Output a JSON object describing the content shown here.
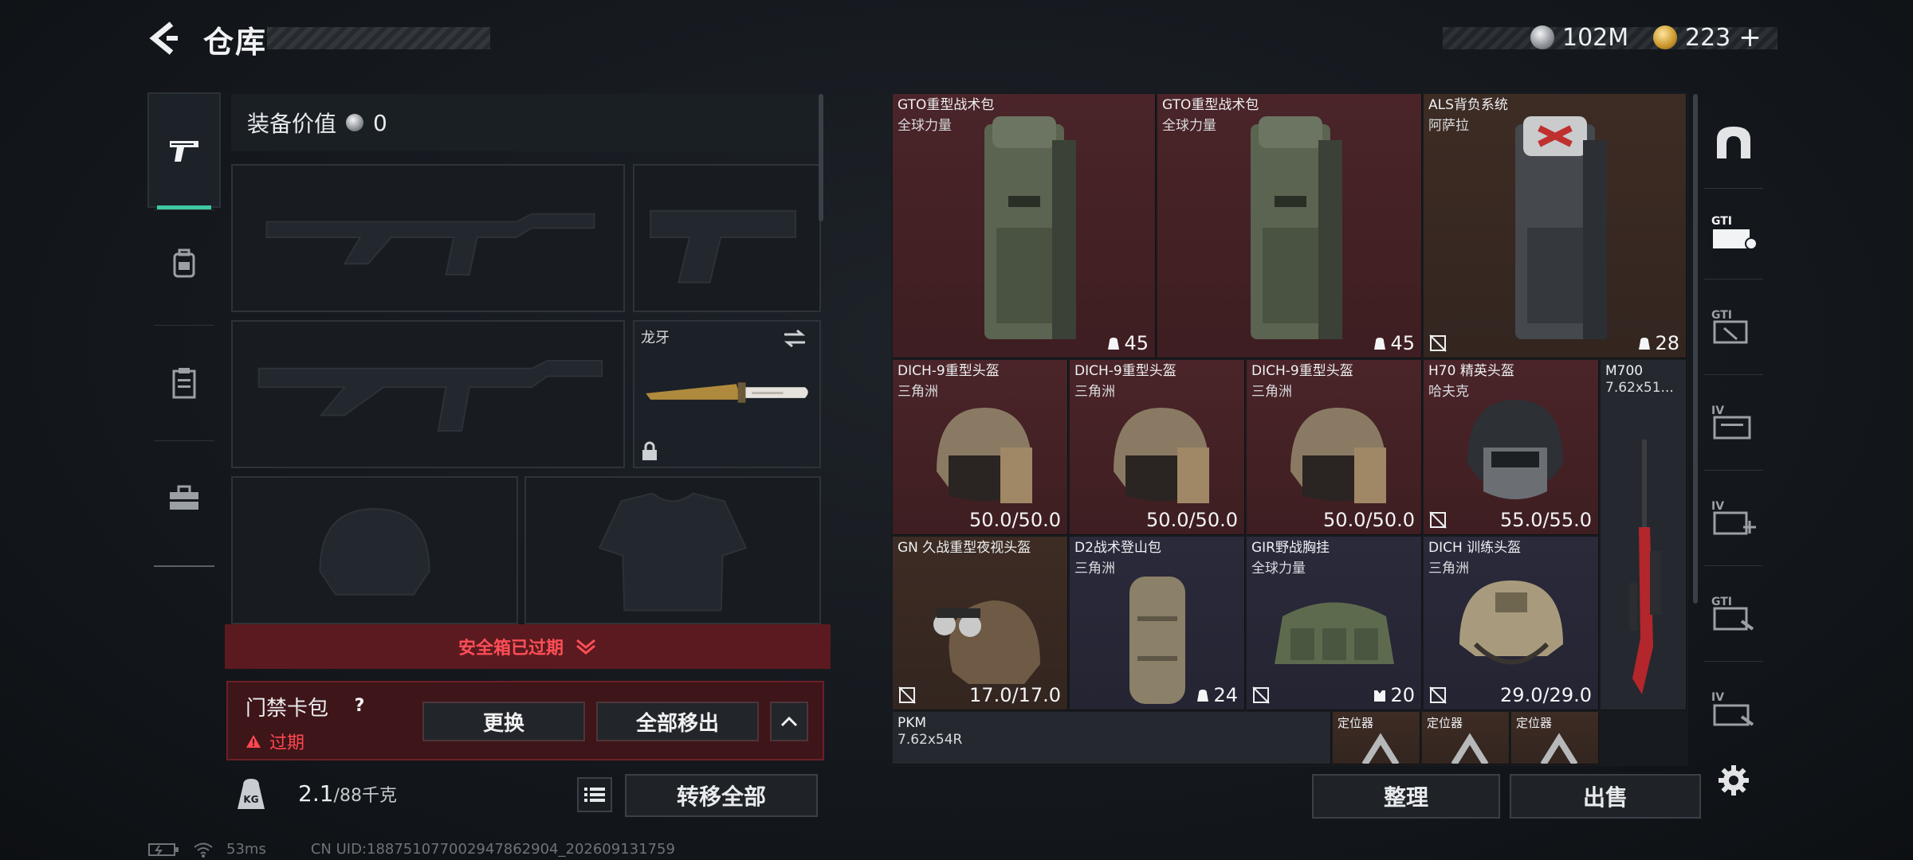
{
  "header": {
    "title": "仓库",
    "currency": [
      {
        "icon": "silver-coin-icon",
        "value": "102M"
      },
      {
        "icon": "gold-coin-icon",
        "value": "223"
      }
    ],
    "add_symbol": "+"
  },
  "left_tabs": [
    {
      "icon": "pistol-icon",
      "active": true
    },
    {
      "icon": "backpack-icon",
      "active": false
    },
    {
      "icon": "clipboard-icon",
      "active": false
    },
    {
      "icon": "toolbox-icon",
      "active": false
    }
  ],
  "loadout": {
    "equip_value_label": "装备价值",
    "equip_value": "0",
    "melee_name": "龙牙",
    "safebox_text": "安全箱已过期",
    "keybag": {
      "title": "门禁卡包",
      "help": "?",
      "status": "过期",
      "replace": "更换",
      "remove_all": "全部移出"
    },
    "weight": {
      "value": "2.1",
      "capacity": "/88千克",
      "icon_text": "KG"
    },
    "transfer_all": "转移全部"
  },
  "storage": {
    "items": [
      {
        "name": "GTO重型战术包",
        "sub": "全球力量",
        "stat": "45",
        "rarity": "red"
      },
      {
        "name": "GTO重型战术包",
        "sub": "全球力量",
        "stat": "45",
        "rarity": "red"
      },
      {
        "name": "ALS背负系统",
        "sub": "阿萨拉",
        "stat": "28",
        "rarity": "orange"
      },
      {
        "name": "DICH-9重型头盔",
        "sub": "三角洲",
        "stat": "50.0/50.0",
        "rarity": "red"
      },
      {
        "name": "DICH-9重型头盔",
        "sub": "三角洲",
        "stat": "50.0/50.0",
        "rarity": "red"
      },
      {
        "name": "DICH-9重型头盔",
        "sub": "三角洲",
        "stat": "50.0/50.0",
        "rarity": "red"
      },
      {
        "name": "H70 精英头盔",
        "sub": "哈夫克",
        "stat": "55.0/55.0",
        "rarity": "red"
      },
      {
        "name": "M700",
        "sub": "7.62x51...",
        "stat": "",
        "rarity": "gray"
      },
      {
        "name": "GN 久战重型夜视头盔",
        "sub": "",
        "stat": "17.0/17.0",
        "rarity": "orange"
      },
      {
        "name": "D2战术登山包",
        "sub": "三角洲",
        "stat": "24",
        "rarity": "purple"
      },
      {
        "name": "GIR野战胸挂",
        "sub": "全球力量",
        "stat": "20",
        "rarity": "purple"
      },
      {
        "name": "DICH 训练头盔",
        "sub": "三角洲",
        "stat": "29.0/29.0",
        "rarity": "purple"
      },
      {
        "name": "PKM",
        "sub": "7.62x54R",
        "stat": "",
        "rarity": "gray"
      },
      {
        "name": "定位器",
        "sub": "",
        "stat": "",
        "rarity": "orange"
      },
      {
        "name": "定位器",
        "sub": "",
        "stat": "",
        "rarity": "orange"
      },
      {
        "name": "定位器",
        "sub": "",
        "stat": "",
        "rarity": "orange"
      }
    ],
    "sort": "整理",
    "sell": "出售"
  },
  "right_tabs": [
    {
      "icon": "vault-icon"
    },
    {
      "icon": "gti-case-icon",
      "label": "GTI"
    },
    {
      "icon": "gti-box-icon",
      "label": "GTI"
    },
    {
      "icon": "iv-folder-icon",
      "label": "IV"
    },
    {
      "icon": "iv-medkit-icon",
      "label": "IV"
    },
    {
      "icon": "gti-wrench-icon",
      "label": "GTI"
    },
    {
      "icon": "iv-case-icon",
      "label": "IV"
    },
    {
      "icon": "settings-gear-icon"
    }
  ],
  "footer": {
    "ping": "53ms",
    "uid": "CN UID:18875107700294786​2904_202609131759"
  },
  "colors": {
    "accent": "#3fc9a4",
    "alert": "#ff4750",
    "rarity_red": "#4a2428",
    "rarity_orange": "#3d2c24",
    "rarity_purple": "#2a2a3b"
  }
}
